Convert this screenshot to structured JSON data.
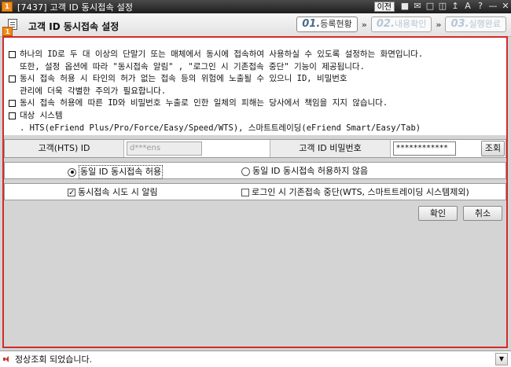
{
  "window": {
    "title": "[7437] 고객 ID 동시접속 설정",
    "badge": "1",
    "link_label": "이전",
    "icons": [
      "lock-icon",
      "mail-icon",
      "screen-icon",
      "bookmark-icon",
      "pin-icon",
      "font-size-icon",
      "help-icon",
      "minimize-icon",
      "close-icon"
    ]
  },
  "header": {
    "title": "고객 ID 동시접속 설정",
    "steps": [
      {
        "num": "01.",
        "label": "등록현황",
        "active": true
      },
      {
        "num": "02.",
        "label": "내용확인",
        "active": false
      },
      {
        "num": "03.",
        "label": "실행완료",
        "active": false
      }
    ],
    "step_separator": "»"
  },
  "panel_badge": "1",
  "notice": {
    "lines": [
      {
        "bullet": true,
        "text": "하나의 ID로 두 대 이상의 단말기 또는 매체에서  동시에 접속하여 사용하실 수 있도록 설정하는 화면입니다."
      },
      {
        "bullet": false,
        "text": "또한, 설정 옵션에 따라  \"동시접속 알림\" ,  \"로그인 시 기존접속 중단\"  기능이 제공됩니다."
      },
      {
        "bullet": true,
        "text": "동시 접속 허용 시 타인의 허가 없는 접속 등의 위험에 노출될 수 있으니 ID, 비밀번호"
      },
      {
        "bullet": false,
        "text": "관리에 더욱 각별한 주의가 필요합니다."
      },
      {
        "bullet": true,
        "text": "동시 접속 허용에 따른 ID와 비밀번호 누출로 인한 일체의 피해는 당사에서 책임을 지지 않습니다."
      },
      {
        "bullet": true,
        "text": "대상 시스템"
      },
      {
        "bullet": false,
        "text": ". HTS(eFriend Plus/Pro/Force/Easy/Speed/WTS), 스마트트레이딩(eFriend Smart/Easy/Tab)"
      }
    ]
  },
  "form": {
    "id_label": "고객(HTS) ID",
    "id_value": "d***ens",
    "pw_label": "고객 ID 비밀번호",
    "pw_value": "************",
    "lookup_label": "조회",
    "radio_allow": "동일 ID 동시접속 허용",
    "radio_deny": "동일 ID 동시접속 허용하지 않음",
    "selected": "allow",
    "check_notify": "동시접속 시도 시 알림",
    "check_notify_checked": true,
    "check_stop": "로그인 시 기존접속 중단(WTS, 스마트트레이딩 시스템제외)",
    "check_stop_checked": false
  },
  "buttons": {
    "ok": "확인",
    "cancel": "취소"
  },
  "status": {
    "text": "정상조회 되었습니다."
  }
}
